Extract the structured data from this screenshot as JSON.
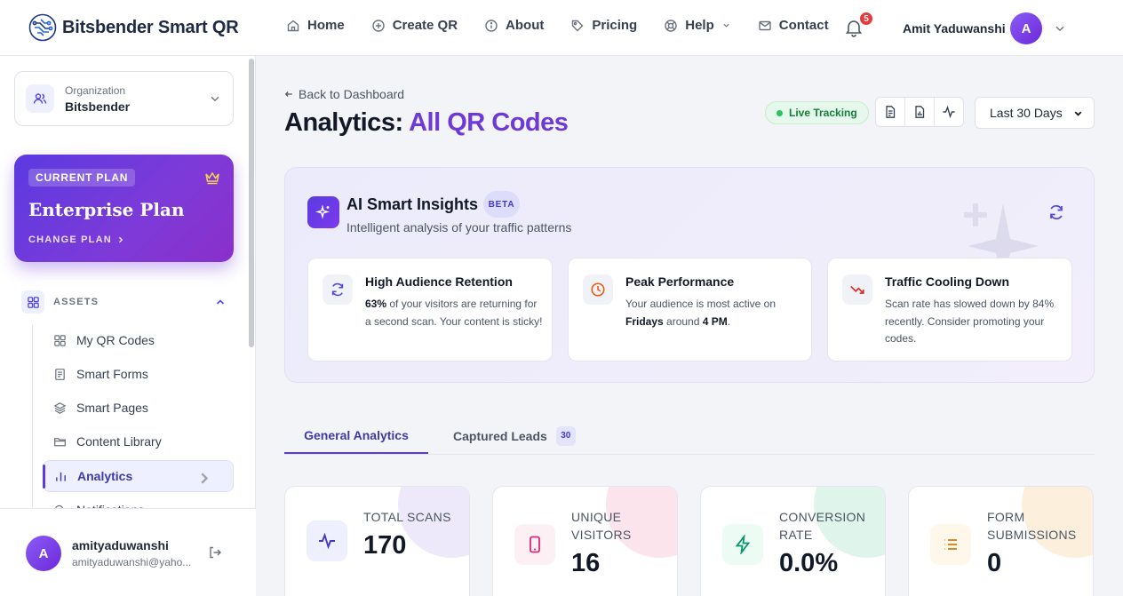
{
  "brand": {
    "name": "Bitsbender Smart QR",
    "logo_icon": "circuit-qr-logo-icon"
  },
  "nav": {
    "items": [
      {
        "label": "Home",
        "icon": "home-icon"
      },
      {
        "label": "Create QR",
        "icon": "plus-circle-icon"
      },
      {
        "label": "About",
        "icon": "info-icon"
      },
      {
        "label": "Pricing",
        "icon": "tag-icon"
      },
      {
        "label": "Help",
        "icon": "lifebuoy-icon"
      },
      {
        "label": "Contact",
        "icon": "mail-icon"
      }
    ],
    "notification_count": "5",
    "user_name": "Amit Yaduwanshi",
    "user_initial": "A"
  },
  "sidebar": {
    "organization": {
      "label": "Organization",
      "value": "Bitsbender"
    },
    "plan": {
      "badge": "CURRENT PLAN",
      "name": "Enterprise Plan",
      "change_label": "CHANGE PLAN"
    },
    "section": {
      "label": "ASSETS"
    },
    "items": [
      {
        "label": "My QR Codes",
        "icon": "grid-icon"
      },
      {
        "label": "Smart Forms",
        "icon": "form-icon"
      },
      {
        "label": "Smart Pages",
        "icon": "layers-icon"
      },
      {
        "label": "Content Library",
        "icon": "folder-icon"
      },
      {
        "label": "Analytics",
        "icon": "bar-chart-icon",
        "active": true
      },
      {
        "label": "Notifications",
        "icon": "search-icon"
      }
    ],
    "user": {
      "initial": "A",
      "username": "amityaduwanshi",
      "email": "amityaduwanshi@yaho..."
    }
  },
  "main": {
    "back_label": "Back to Dashboard",
    "title_prefix": "Analytics:",
    "title_accent": "All QR Codes",
    "live_label": "Live Tracking",
    "range": {
      "selected": "Last 30 Days"
    },
    "colors": {
      "accent": "#6d3ad8",
      "live": "#15803d"
    }
  },
  "ai": {
    "title": "AI Smart Insights",
    "beta": "BETA",
    "subtitle": "Intelligent analysis of your traffic patterns",
    "insights": [
      {
        "title": "High Audience Retention",
        "icon": "refresh-icon",
        "pre": "",
        "bold1": "63%",
        "mid": " of your visitors are returning for a second scan. Your content is sticky!",
        "bold2": "",
        "post": ""
      },
      {
        "title": "Peak Performance",
        "icon": "clock-icon",
        "pre": "Your audience is most active on ",
        "bold1": "Fridays",
        "mid": " around ",
        "bold2": "4 PM",
        "post": "."
      },
      {
        "title": "Traffic Cooling Down",
        "icon": "trend-down-icon",
        "pre": "Scan rate has slowed down by 84% recently. Consider promoting your codes.",
        "bold1": "",
        "mid": "",
        "bold2": "",
        "post": ""
      }
    ]
  },
  "tabs": {
    "general": "General Analytics",
    "leads": "Captured Leads",
    "leads_count": "30"
  },
  "stats": [
    {
      "label": "TOTAL SCANS",
      "value": "170",
      "icon": "activity-icon",
      "color": "#4338ca"
    },
    {
      "label": "UNIQUE VISITORS",
      "value": "16",
      "icon": "phone-icon",
      "color": "#db2777"
    },
    {
      "label": "CONVERSION RATE",
      "value": "0.0%",
      "icon": "bolt-icon",
      "color": "#059669"
    },
    {
      "label": "FORM SUBMISSIONS",
      "value": "0",
      "icon": "list-icon",
      "color": "#d97706"
    }
  ]
}
